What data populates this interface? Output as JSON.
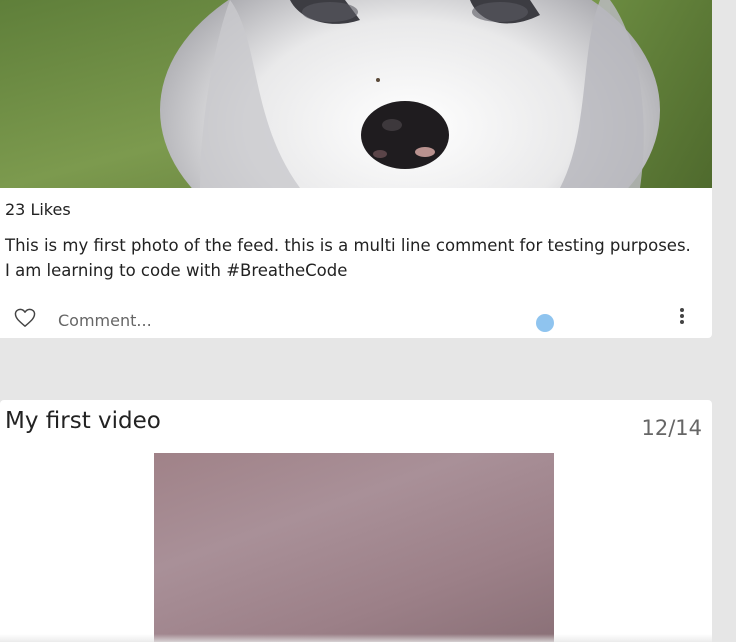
{
  "post": {
    "likes": "23 Likes",
    "caption_line1": "This is my first photo of the feed. this is a multi line comment for testing purposes.",
    "caption_line2": "I am learning to code with #BreatheCode",
    "comment_placeholder": "Comment...",
    "photo_alt": "puppy photo",
    "icons": {
      "like": "heart-outline-icon",
      "more": "more-vertical-icon"
    }
  },
  "video_post": {
    "title": "My first video",
    "date": "12/14"
  },
  "colors": {
    "background": "#e6e6e6",
    "card": "#ffffff",
    "cursor": "#8fc4ef"
  }
}
